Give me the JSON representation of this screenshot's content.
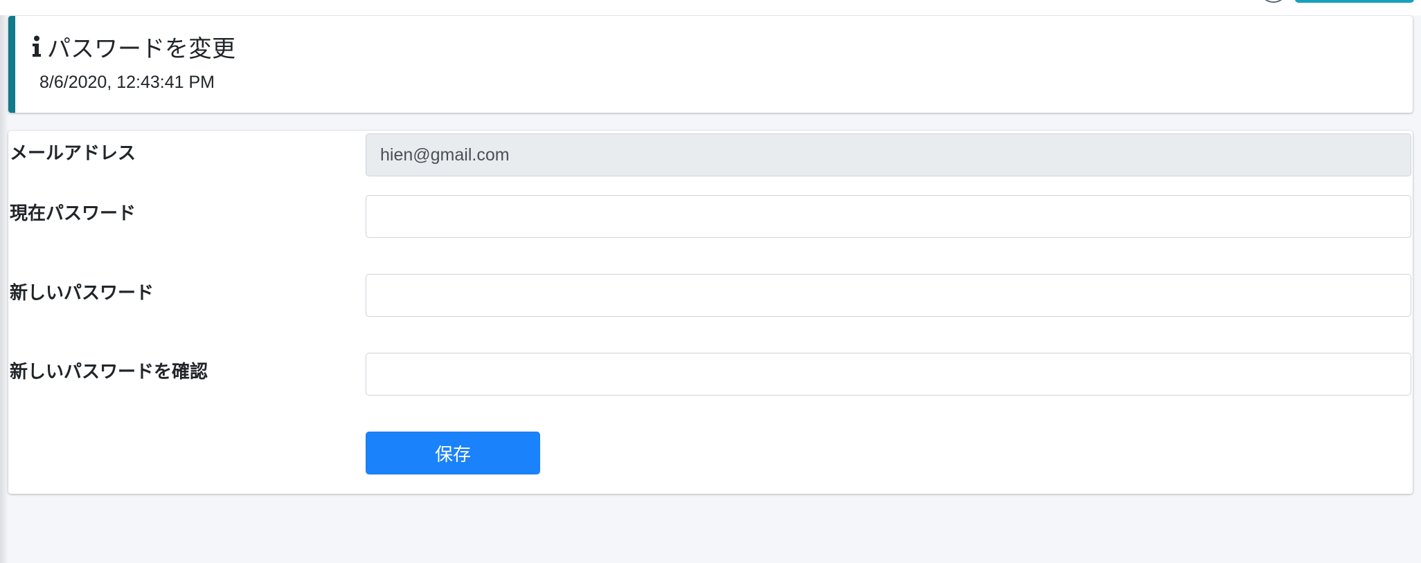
{
  "callout": {
    "title": "パスワードを変更",
    "icon": "info-icon",
    "datetime": "8/6/2020, 12:43:41 PM",
    "accent_color": "#117a8b"
  },
  "form": {
    "email": {
      "label": "メールアドレス",
      "value": "hien@gmail.com",
      "readonly": true
    },
    "current_password": {
      "label": "現在パスワード",
      "value": ""
    },
    "new_password": {
      "label": "新しいパスワード",
      "value": ""
    },
    "confirm_password": {
      "label": "新しいパスワードを確認",
      "value": ""
    },
    "save_label": "保存",
    "save_color": "#1a82fa"
  }
}
